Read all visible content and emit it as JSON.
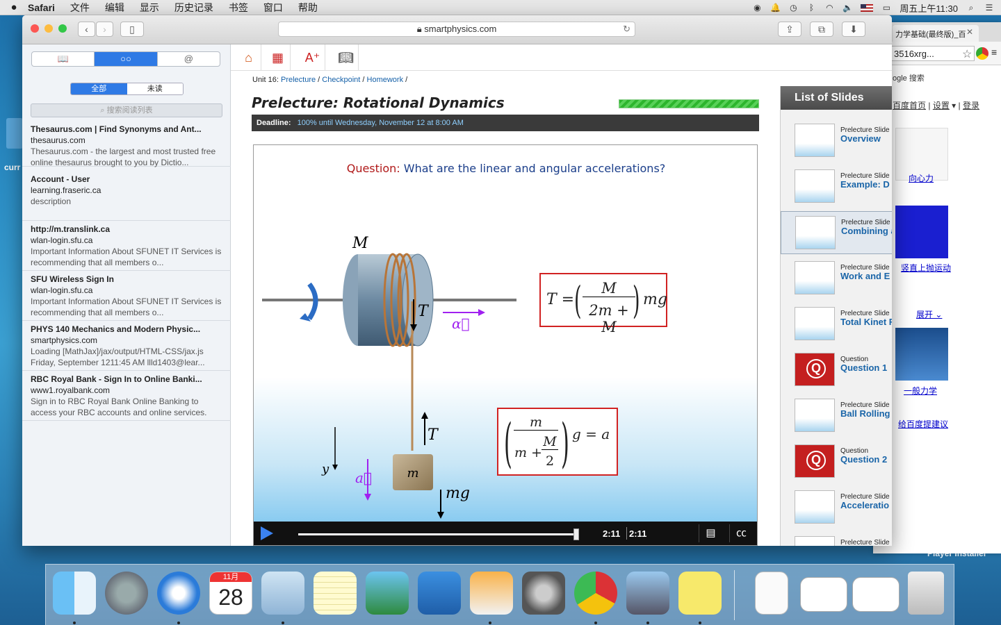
{
  "menubar": {
    "apple": "",
    "app": "Safari",
    "items": [
      "文件",
      "编辑",
      "显示",
      "历史记录",
      "书签",
      "窗口",
      "帮助"
    ],
    "clock": "周五上午11:30"
  },
  "desktop": {
    "folder_label": "curr",
    "player_label": "Player Installer"
  },
  "chrome": {
    "tab_title": "力学基础(最终版)_百",
    "url_partial": "3516xrg...",
    "top_links": [
      "百度首页",
      "设置",
      "登录"
    ],
    "results": [
      {
        "label": "向心力"
      },
      {
        "label": "竖直上抛运动"
      },
      {
        "label": "展开"
      },
      {
        "label": "一般力学"
      },
      {
        "label": "给百度提建议"
      }
    ],
    "search_btn": "ogle 搜索"
  },
  "safari": {
    "url": "smartphysics.com",
    "sidebar": {
      "tabs": [
        "📖",
        "○○",
        "@"
      ],
      "filter": [
        "全部",
        "未读"
      ],
      "search_placeholder": "搜索阅读列表",
      "items": [
        {
          "title": "Thesaurus.com | Find Synonyms and Ant...",
          "url": "thesaurus.com",
          "desc": "Thesaurus.com - the largest and most trusted free online thesaurus brought to you by Dictio..."
        },
        {
          "title": "Account - User",
          "url": "learning.fraseric.ca",
          "desc": "description"
        },
        {
          "title": "http://m.translink.ca",
          "url": "wlan-login.sfu.ca",
          "desc": "Important Information About SFUNET IT Services is recommending that all members o..."
        },
        {
          "title": "SFU Wireless Sign In",
          "url": "wlan-login.sfu.ca",
          "desc": "Important Information About SFUNET IT Services is recommending that all members o..."
        },
        {
          "title": "PHYS 140 Mechanics and Modern Physic...",
          "url": "smartphysics.com",
          "desc": "Loading [MathJax]/jax/output/HTML-CSS/jax.js Friday, September 1211:45 AM llld1403@lear..."
        },
        {
          "title": "RBC Royal Bank - Sign In to Online Banki...",
          "url": "www1.royalbank.com",
          "desc": "Sign in to RBC Royal Bank Online Banking to access your RBC accounts and online services."
        }
      ]
    },
    "page": {
      "unit": "Unit 16:",
      "crumbs": [
        "Prelecture",
        "Checkpoint",
        "Homework"
      ],
      "title": "Prelecture: Rotational Dynamics",
      "progress": 1.0,
      "deadline_label": "Deadline:",
      "deadline_value": "100% until Wednesday, November 12 at 8:00 AM",
      "question_label": "Question:",
      "question_text": "What are the linear and angular accelerations?",
      "diagram": {
        "M": "M",
        "T": "T",
        "alpha": "α⃗",
        "m": "m",
        "mg": "mg",
        "y": "y",
        "a": "a⃗"
      },
      "formula1": {
        "lhs": "T =",
        "num": "M",
        "den": "2m + M",
        "rhs": "mg"
      },
      "formula2": {
        "num": "m",
        "den_m": "m +",
        "den_M": "M",
        "den_2": "2",
        "rhs": "g = a"
      },
      "player": {
        "elapsed": "2:11",
        "total": "2:11",
        "progress": 1.0
      },
      "slides_header": "List of Slides",
      "slides": [
        {
          "kind": "Prelecture Slide",
          "name": "Overview"
        },
        {
          "kind": "Prelecture Slide",
          "name": "Example: D"
        },
        {
          "kind": "Prelecture Slide",
          "name": "Combining and Rotatio",
          "selected": true
        },
        {
          "kind": "Prelecture Slide",
          "name": "Work and E Rotations"
        },
        {
          "kind": "Prelecture Slide",
          "name": "Total Kinet Rolling Ball"
        },
        {
          "kind": "Question",
          "name": "Question 1",
          "q": true
        },
        {
          "kind": "Prelecture Slide",
          "name": "Ball Rolling"
        },
        {
          "kind": "Question",
          "name": "Question 2",
          "q": true
        },
        {
          "kind": "Prelecture Slide",
          "name": "Acceleratio Ball"
        },
        {
          "kind": "Prelecture Slide",
          "name": ""
        }
      ]
    }
  },
  "dock": {
    "calendar_month": "11月",
    "calendar_day": "28"
  }
}
